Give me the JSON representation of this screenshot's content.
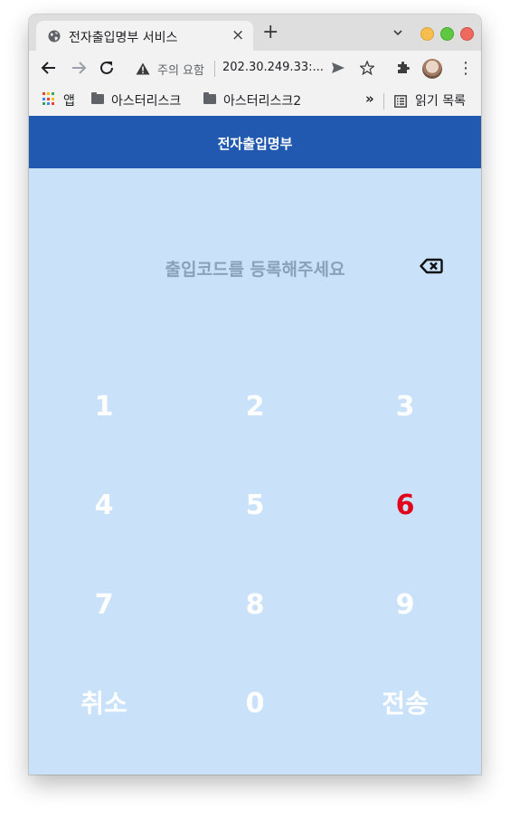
{
  "browser": {
    "tab_title": "전자출입명부 서비스",
    "tab_close": "×",
    "new_tab": "+",
    "security_warning": "주의 요함",
    "url": "202.30.249.33:...",
    "menu_glyph": "⋮",
    "bookmarks": {
      "apps_label": "앱",
      "folder1": "아스터리스크",
      "folder2": "아스터리스크2",
      "overflow": "»",
      "reading_list": "읽기 목록"
    }
  },
  "app": {
    "title": "전자출입명부",
    "prompt": "출입코드를 등록해주세요",
    "keys": {
      "k1": "1",
      "k2": "2",
      "k3": "3",
      "k4": "4",
      "k5": "5",
      "k6": "6",
      "k7": "7",
      "k8": "8",
      "k9": "9",
      "cancel": "취소",
      "k0": "0",
      "submit": "전송"
    },
    "colors": {
      "header": "#2158b0",
      "background": "#c9e2fa",
      "key_text": "#ffffff",
      "highlight_key": "#e2001b",
      "prompt_text": "#8aa1b8"
    }
  }
}
